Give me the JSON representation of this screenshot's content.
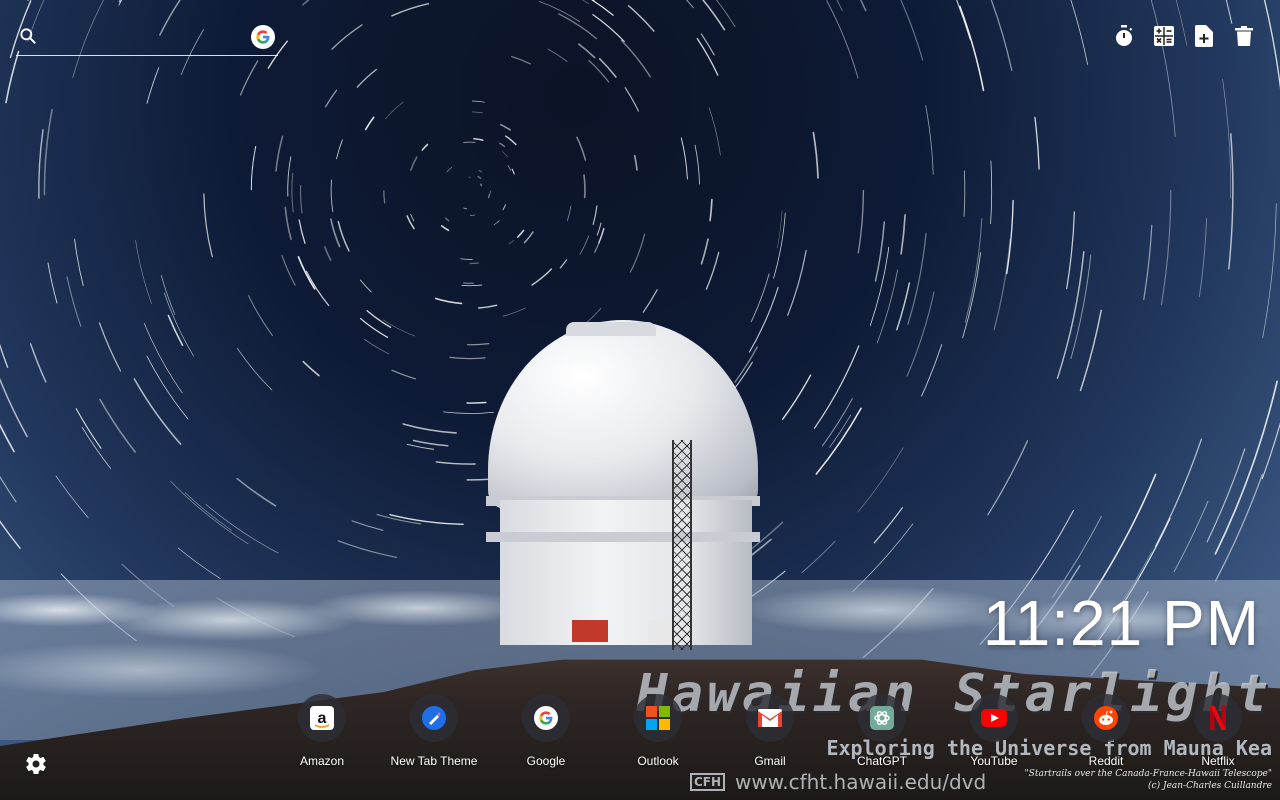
{
  "search": {
    "placeholder": "",
    "icon": "search-icon",
    "engine_icon": "google-icon"
  },
  "toolbar": [
    {
      "name": "timer-icon"
    },
    {
      "name": "calculator-icon"
    },
    {
      "name": "new-note-icon"
    },
    {
      "name": "trash-icon"
    }
  ],
  "clock": {
    "time": "11:21 PM"
  },
  "quick_links": [
    {
      "label": "Amazon",
      "icon": "amazon-icon",
      "color": "#ffffff"
    },
    {
      "label": "New Tab Theme",
      "icon": "new-tab-theme-icon",
      "color": "#1e6ee8"
    },
    {
      "label": "Google",
      "icon": "google-icon",
      "color": "#ffffff"
    },
    {
      "label": "Outlook",
      "icon": "microsoft-icon",
      "color": "#f25022"
    },
    {
      "label": "Gmail",
      "icon": "gmail-icon",
      "color": "#ea4335"
    },
    {
      "label": "ChatGPT",
      "icon": "chatgpt-icon",
      "color": "#74aa9c"
    },
    {
      "label": "YouTube",
      "icon": "youtube-icon",
      "color": "#ff0000"
    },
    {
      "label": "Reddit",
      "icon": "reddit-icon",
      "color": "#ff4500"
    },
    {
      "label": "Netflix",
      "icon": "netflix-icon",
      "color": "#e50914"
    }
  ],
  "watermark": {
    "title": "Hawaiian Starlight",
    "subtitle": "Exploring the Universe from Mauna Kea",
    "logo": "CFH",
    "url": "www.cfht.hawaii.edu/dvd",
    "credit_line1": "\"Startrails over the Canada-France-Hawaii Telescope\"",
    "credit_line2": "(c) Jean-Charles Cuillandre"
  },
  "settings": {
    "icon": "settings-gear-icon"
  }
}
